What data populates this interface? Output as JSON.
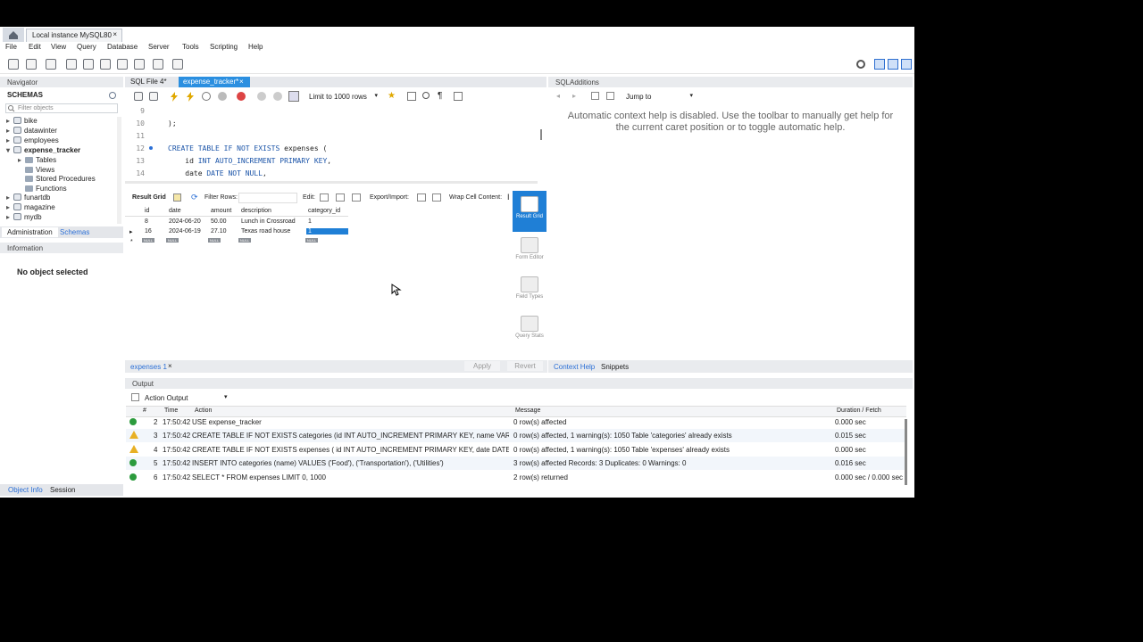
{
  "tabs": {
    "connection": "Local instance MySQL80",
    "close": "×"
  },
  "menu": [
    "File",
    "Edit",
    "View",
    "Query",
    "Database",
    "Server",
    "Tools",
    "Scripting",
    "Help"
  ],
  "navigator": {
    "header": "Navigator",
    "schemas_label": "SCHEMAS",
    "filter_placeholder": "Filter objects",
    "schemas": [
      "bike",
      "datawinter",
      "employees",
      "expense_tracker",
      "funartdb",
      "magazine",
      "mydb"
    ],
    "expense_children": [
      "Tables",
      "Views",
      "Stored Procedures",
      "Functions"
    ],
    "bottom_tabs": [
      "Administration",
      "Schemas"
    ]
  },
  "information": {
    "header": "Information",
    "message": "No object selected",
    "bottom_tabs": [
      "Object Info",
      "Session"
    ]
  },
  "editor": {
    "tabs": [
      "SQL File 4*",
      "expense_tracker*"
    ],
    "limit": "Limit to 1000 rows",
    "lines": [
      {
        "n": "9",
        "code": ""
      },
      {
        "n": "10",
        "code": ");"
      },
      {
        "n": "11",
        "code": ""
      },
      {
        "n": "12",
        "code": "CREATE TABLE IF NOT EXISTS expenses ("
      },
      {
        "n": "13",
        "code": "    id INT AUTO_INCREMENT PRIMARY KEY,"
      },
      {
        "n": "14",
        "code": "    date DATE NOT NULL,"
      }
    ]
  },
  "result": {
    "toolbar": {
      "result_grid": "Result Grid",
      "filter_rows": "Filter Rows:",
      "edit": "Edit:",
      "export": "Export/Import:",
      "wrap": "Wrap Cell Content:"
    },
    "columns": [
      "id",
      "date",
      "amount",
      "description",
      "category_id"
    ],
    "rows": [
      [
        "8",
        "2024-06-20",
        "50.00",
        "Lunch in Crossroad",
        "1"
      ],
      [
        "16",
        "2024-06-19",
        "27.10",
        "Texas road house",
        "1"
      ]
    ],
    "null_label": "NULL",
    "side": [
      "Result Grid",
      "Form Editor",
      "Field Types",
      "Query Stats"
    ],
    "bottom_tab": "expenses 1",
    "apply": "Apply",
    "revert": "Revert"
  },
  "sqladditions": {
    "header": "SQLAdditions",
    "jump_to": "Jump to",
    "help_text": "Automatic context help is disabled. Use the toolbar to manually get help for the current caret position or to toggle automatic help.",
    "tabs": [
      "Context Help",
      "Snippets"
    ]
  },
  "output": {
    "header": "Output",
    "selector": "Action Output",
    "columns": [
      "#",
      "Time",
      "Action",
      "Message",
      "Duration / Fetch"
    ],
    "rows": [
      {
        "status": "ok",
        "n": "2",
        "time": "17:50:42",
        "action": "USE expense_tracker",
        "message": "0 row(s) affected",
        "duration": "0.000 sec"
      },
      {
        "status": "warn",
        "n": "3",
        "time": "17:50:42",
        "action": "CREATE TABLE IF NOT EXISTS categories (id INT AUTO_INCREMENT PRIMARY KEY,     name VARCHA...",
        "message": "0 row(s) affected, 1 warning(s): 1050 Table 'categories' already exists",
        "duration": "0.015 sec"
      },
      {
        "status": "warn",
        "n": "4",
        "time": "17:50:42",
        "action": "CREATE TABLE IF NOT EXISTS expenses (     id INT AUTO_INCREMENT PRIMARY KEY,     date DATE N...",
        "message": "0 row(s) affected, 1 warning(s): 1050 Table 'expenses' already exists",
        "duration": "0.000 sec"
      },
      {
        "status": "ok",
        "n": "5",
        "time": "17:50:42",
        "action": "INSERT INTO categories (name) VALUES ('Food'), ('Transportation'), ('Utilities')",
        "message": "3 row(s) affected Records: 3  Duplicates: 0  Warnings: 0",
        "duration": "0.016 sec"
      },
      {
        "status": "ok",
        "n": "6",
        "time": "17:50:42",
        "action": "SELECT * FROM expenses LIMIT 0, 1000",
        "message": "2 row(s) returned",
        "duration": "0.000 sec / 0.000 sec"
      }
    ]
  }
}
